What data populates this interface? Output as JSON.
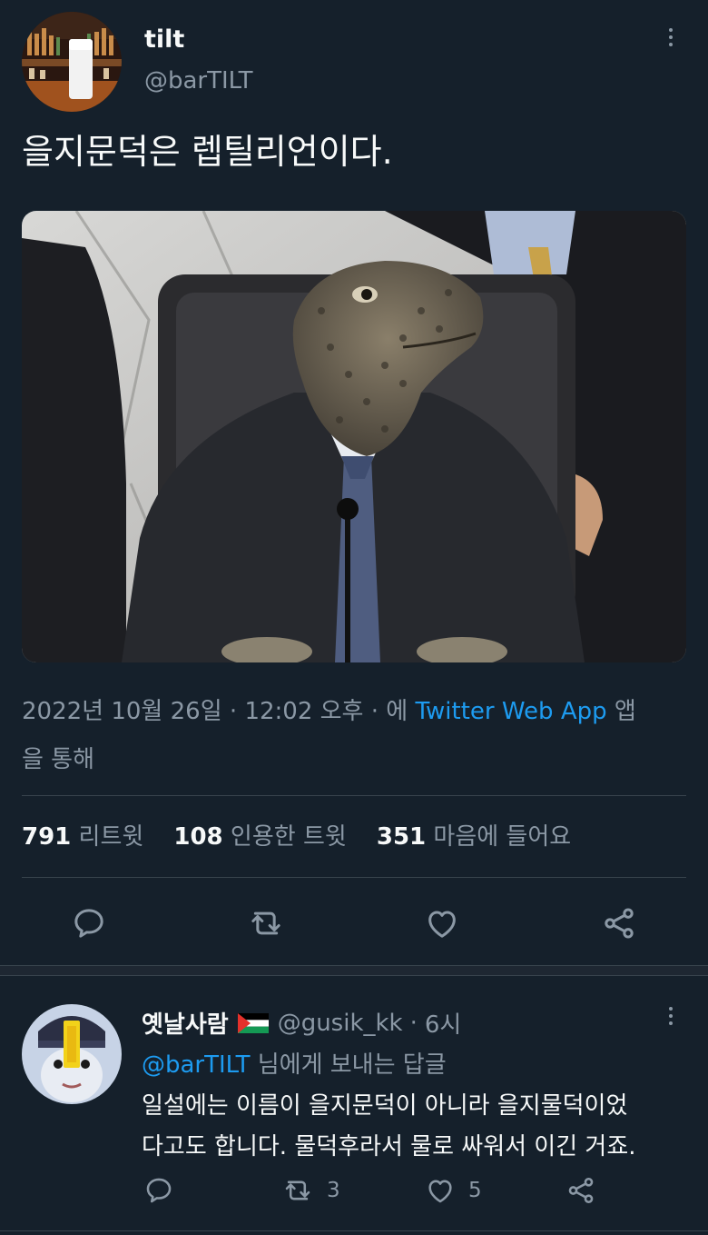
{
  "tweet": {
    "author_name": "tilt",
    "author_handle": "@barTILT",
    "text": "을지문덕은 렙틸리언이다.",
    "image_alt": "lizard-headed man in a suit at a hearing",
    "meta": {
      "date": "2022년 10월 26일",
      "sep1": "·",
      "time": "12:02 오후",
      "sep2": "·",
      "via_prefix": "에",
      "source": "Twitter Web App",
      "via_suffix_1": "앱",
      "via_suffix_2": "을 통해"
    },
    "stats": {
      "retweets_count": "791",
      "retweets_label": "리트윗",
      "quotes_count": "108",
      "quotes_label": "인용한 트윗",
      "likes_count": "351",
      "likes_label": "마음에 들어요"
    },
    "actions": [
      "reply-icon",
      "retweet-icon",
      "like-icon",
      "share-icon"
    ]
  },
  "reply": {
    "author_name": "옛날사람",
    "flag": "palestine-flag",
    "author_handle": "@gusik_kk",
    "separator": "·",
    "time": "6시",
    "replying_handle": "@barTILT",
    "replying_suffix": "님에게 보내는 답글",
    "text_line1": "일설에는 이름이 을지문덕이 아니라 을지물덕이었",
    "text_line2": "다고도 합니다. 물덕후라서 물로 싸워서 이긴 거죠.",
    "retweet_count": "3",
    "like_count": "5"
  },
  "colors": {
    "background": "#15202b",
    "text": "#f7f9f9",
    "muted": "#8b98a5",
    "accent": "#1d9bf0",
    "divider": "#38444d"
  }
}
